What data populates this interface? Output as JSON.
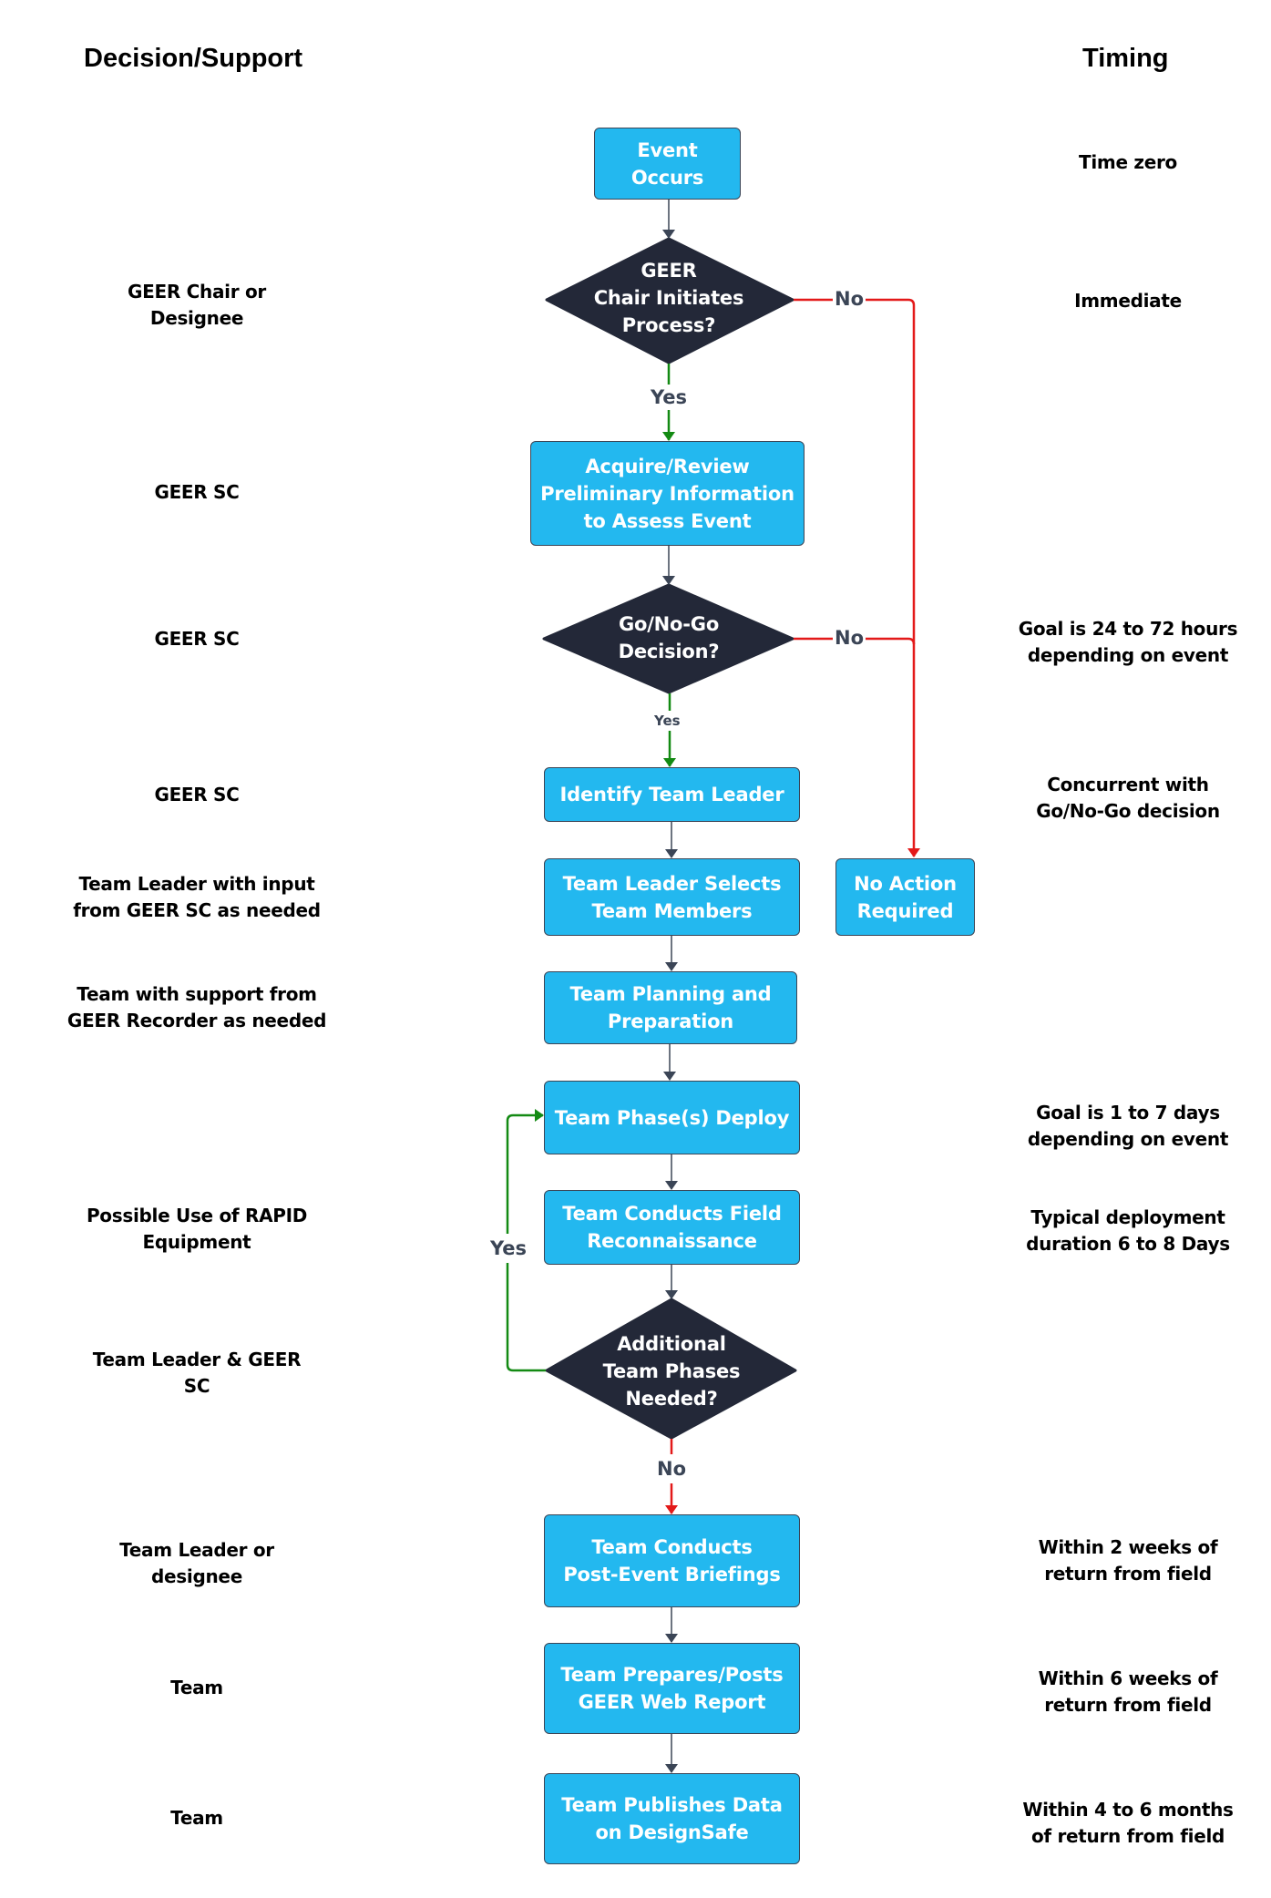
{
  "headers": {
    "left": "Decision/Support",
    "right": "Timing"
  },
  "colors": {
    "process_fill": "#23b8ef",
    "decision_fill": "#232838",
    "yes_line": "#138a13",
    "no_line": "#e31919",
    "default_line": "#3b4556"
  },
  "nodes": {
    "event_occurs": "Event Occurs",
    "chair_initiates": "GEER Chair Initiates Process?",
    "acquire_review": "Acquire/Review Preliminary Information to Assess Event",
    "go_no_go": "Go/No-Go Decision?",
    "identify_leader": "Identify Team Leader",
    "leader_selects": "Team Leader Selects Team Members",
    "no_action": "No Action Required",
    "planning": "Team Planning and Preparation",
    "deploy": "Team Phase(s) Deploy",
    "field_recon": "Team Conducts Field Reconnaissance",
    "additional_phases": "Additional Team Phases Needed?",
    "briefings": "Team Conducts Post-Event Briefings",
    "web_report": "Team Prepares/Posts GEER Web Report",
    "designsafe": "Team Publishes Data on DesignSafe"
  },
  "node_lines": {
    "event_occurs": [
      "Event",
      "Occurs"
    ],
    "chair_initiates": [
      "GEER",
      "Chair Initiates",
      "Process?"
    ],
    "acquire_review": [
      "Acquire/Review",
      "Preliminary Information",
      "to Assess Event"
    ],
    "go_no_go": [
      "Go/No-Go",
      "Decision?"
    ],
    "leader_selects": [
      "Team Leader Selects",
      "Team Members"
    ],
    "no_action": [
      "No Action",
      "Required"
    ],
    "planning": [
      "Team Planning and",
      "Preparation"
    ],
    "field_recon": [
      "Team Conducts Field",
      "Reconnaissance"
    ],
    "additional_phases": [
      "Additional",
      "Team Phases",
      "Needed?"
    ],
    "briefings": [
      "Team Conducts",
      "Post-Event Briefings"
    ],
    "web_report": [
      "Team Prepares/Posts",
      "GEER Web Report"
    ],
    "designsafe": [
      "Team Publishes Data",
      "on DesignSafe"
    ]
  },
  "edge_labels": {
    "chair_no": "No",
    "chair_yes": "Yes",
    "gonogo_no": "No",
    "gonogo_yes": "Yes",
    "additional_yes": "Yes",
    "additional_no": "No"
  },
  "decision_support": {
    "chair": [
      "GEER Chair or",
      "Designee"
    ],
    "acquire": [
      "GEER SC"
    ],
    "gonogo": [
      "GEER SC"
    ],
    "identify": [
      "GEER SC"
    ],
    "selects": [
      "Team Leader with input",
      "from GEER SC as needed"
    ],
    "planning": [
      "Team with support from",
      "GEER Recorder as needed"
    ],
    "recon": [
      "Possible Use of RAPID",
      "Equipment"
    ],
    "additional": [
      "Team Leader & GEER",
      "SC"
    ],
    "briefings": [
      "Team Leader or",
      "designee"
    ],
    "web_report": [
      "Team"
    ],
    "designsafe": [
      "Team"
    ]
  },
  "timing": {
    "event": [
      "Time zero"
    ],
    "chair": [
      "Immediate"
    ],
    "gonogo": [
      "Goal is 24 to 72 hours",
      "depending on event"
    ],
    "identify": [
      "Concurrent with",
      "Go/No-Go decision"
    ],
    "deploy": [
      "Goal is 1 to 7 days",
      "depending on event"
    ],
    "recon": [
      "Typical deployment",
      "duration 6 to 8 Days"
    ],
    "briefings": [
      "Within 2 weeks of",
      "return from field"
    ],
    "web_report": [
      "Within 6 weeks of",
      "return from field"
    ],
    "designsafe": [
      "Within 4 to 6 months",
      "of return from field"
    ]
  }
}
